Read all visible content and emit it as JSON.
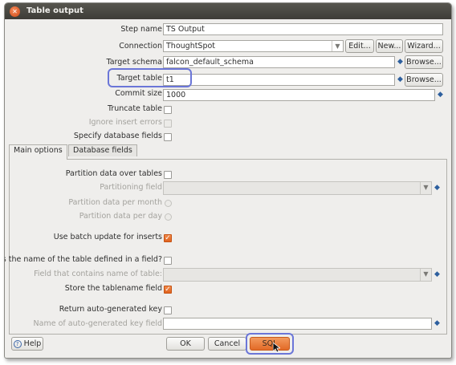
{
  "window": {
    "title": "Table output"
  },
  "fields": {
    "step_name": {
      "label": "Step name",
      "value": "TS Output"
    },
    "connection": {
      "label": "Connection",
      "value": "ThoughtSpot"
    },
    "target_schema": {
      "label": "Target schema",
      "value": "falcon_default_schema"
    },
    "target_table": {
      "label": "Target table",
      "value": "t1"
    },
    "commit_size": {
      "label": "Commit size",
      "value": "1000"
    },
    "truncate_table": {
      "label": "Truncate table"
    },
    "ignore_insert_errors": {
      "label": "Ignore insert errors"
    },
    "specify_database_fields": {
      "label": "Specify database fields"
    }
  },
  "buttons": {
    "edit": "Edit...",
    "new": "New...",
    "wizard": "Wizard...",
    "browse_schema": "Browse...",
    "browse_table": "Browse...",
    "help": "Help",
    "ok": "OK",
    "cancel": "Cancel",
    "sql": "SQL"
  },
  "tabs": [
    {
      "label": "Main options",
      "active": true
    },
    {
      "label": "Database fields",
      "active": false
    }
  ],
  "main_options": {
    "partition_over_tables": "Partition data over tables",
    "partitioning_field": "Partitioning field",
    "partition_per_month": "Partition data per month",
    "partition_per_day": "Partition data per day",
    "use_batch_update": "Use batch update for inserts",
    "table_name_in_field": "Is the name of the table defined in a field?",
    "field_contains_table_name": "Field that contains name of table:",
    "store_tablename_field": "Store the tablename field",
    "return_auto_key": "Return auto-generated key",
    "auto_key_field_name": "Name of auto-generated key field"
  },
  "state": {
    "use_batch_update": true,
    "store_tablename_field": true
  },
  "colors": {
    "titlebar": "#3d3c37",
    "accent_checkbox": "#e0631f",
    "highlight": "#6b76d8",
    "variable_icon": "#2d5f9e"
  }
}
